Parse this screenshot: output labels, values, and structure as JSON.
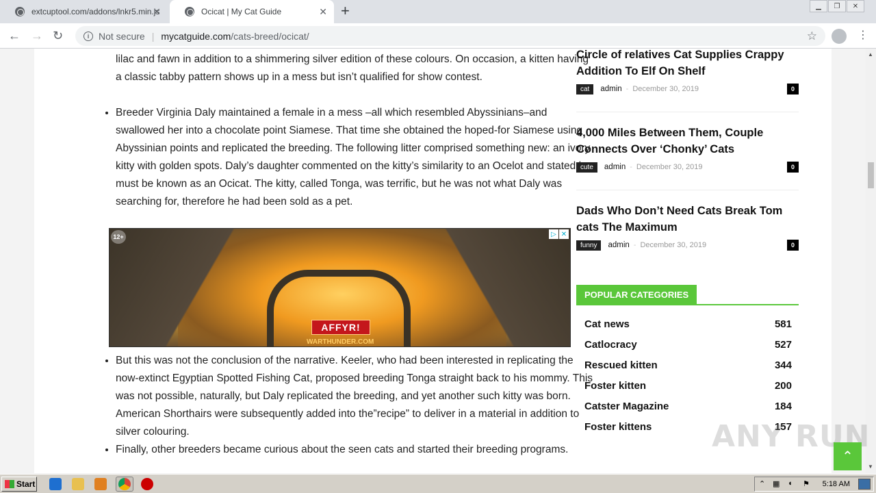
{
  "browser": {
    "tabs": [
      {
        "title": "extcuptool.com/addons/lnkr5.min.js",
        "active": false
      },
      {
        "title": "Ocicat | My Cat Guide",
        "active": true
      }
    ],
    "new_tab_symbol": "+",
    "close_symbol": "✕",
    "security_label": "Not secure",
    "url_host": "mycatguide.com",
    "url_path": "/cats-breed/ocicat/"
  },
  "article": {
    "fragment": "lilac and fawn in addition to a shimmering silver edition of these colours. On occasion, a kitten having a classic tabby pattern shows up in a mess but isn’t qualified for show contest.",
    "bullet_1": "Breeder Virginia Daly maintained a female in a mess –all which resembled Abyssinians–and swallowed her into a chocolate point Siamese. That time she obtained the hoped-for Siamese using Abyssinian points and replicated the breeding. The following litter comprised something new: an ivory kitty with golden spots. Daly’s daughter commented on the kitty’s similarity to an Ocelot and stated he must be known as an Ocicat. The kitty, called Tonga, was terrific, but he was not what Daly was searching for, therefore he had been sold as a pet.",
    "bullet_2": "But this was not the conclusion of the narrative. Keeler, who had been interested in replicating the now-extinct Egyptian Spotted Fishing Cat, proposed breeding Tonga straight back to his mommy. This was not possible, naturally, but Daly replicated the breeding, and yet another such kitty was born. American Shorthairs were subsequently added into the”recipe” to deliver in a material in addition to silver colouring.",
    "bullet_3": "Finally, other breeders became curious about the seen cats and started their breeding programs."
  },
  "ad": {
    "age_badge": "12+",
    "cta": "AFFYR!",
    "site": "WARTHUNDER.COM"
  },
  "sidebar": {
    "posts": [
      {
        "title": "Circle of relatives Cat Supplies Crappy Addition To Elf On Shelf",
        "tag": "cat",
        "author": "admin",
        "date": "December 30, 2019",
        "comments": "0"
      },
      {
        "title": "4,000 Miles Between Them, Couple Connects Over ‘Chonky’ Cats",
        "tag": "cute",
        "author": "admin",
        "date": "December 30, 2019",
        "comments": "0"
      },
      {
        "title": "Dads Who Don’t Need Cats Break Tom cats The Maximum",
        "tag": "funny",
        "author": "admin",
        "date": "December 30, 2019",
        "comments": "0"
      }
    ],
    "popular_heading": "POPULAR CATEGORIES",
    "categories": [
      {
        "name": "Cat news",
        "count": "581"
      },
      {
        "name": "Catlocracy",
        "count": "527"
      },
      {
        "name": "Rescued kitten",
        "count": "344"
      },
      {
        "name": "Foster kitten",
        "count": "200"
      },
      {
        "name": "Catster Magazine",
        "count": "184"
      },
      {
        "name": "Foster kittens",
        "count": "157"
      }
    ]
  },
  "watermark": "ANY RUN",
  "taskbar": {
    "start_label": "Start",
    "clock": "5:18 AM"
  },
  "colors": {
    "accent_green": "#5ac73a",
    "ad_cta_red": "#c4161c"
  }
}
